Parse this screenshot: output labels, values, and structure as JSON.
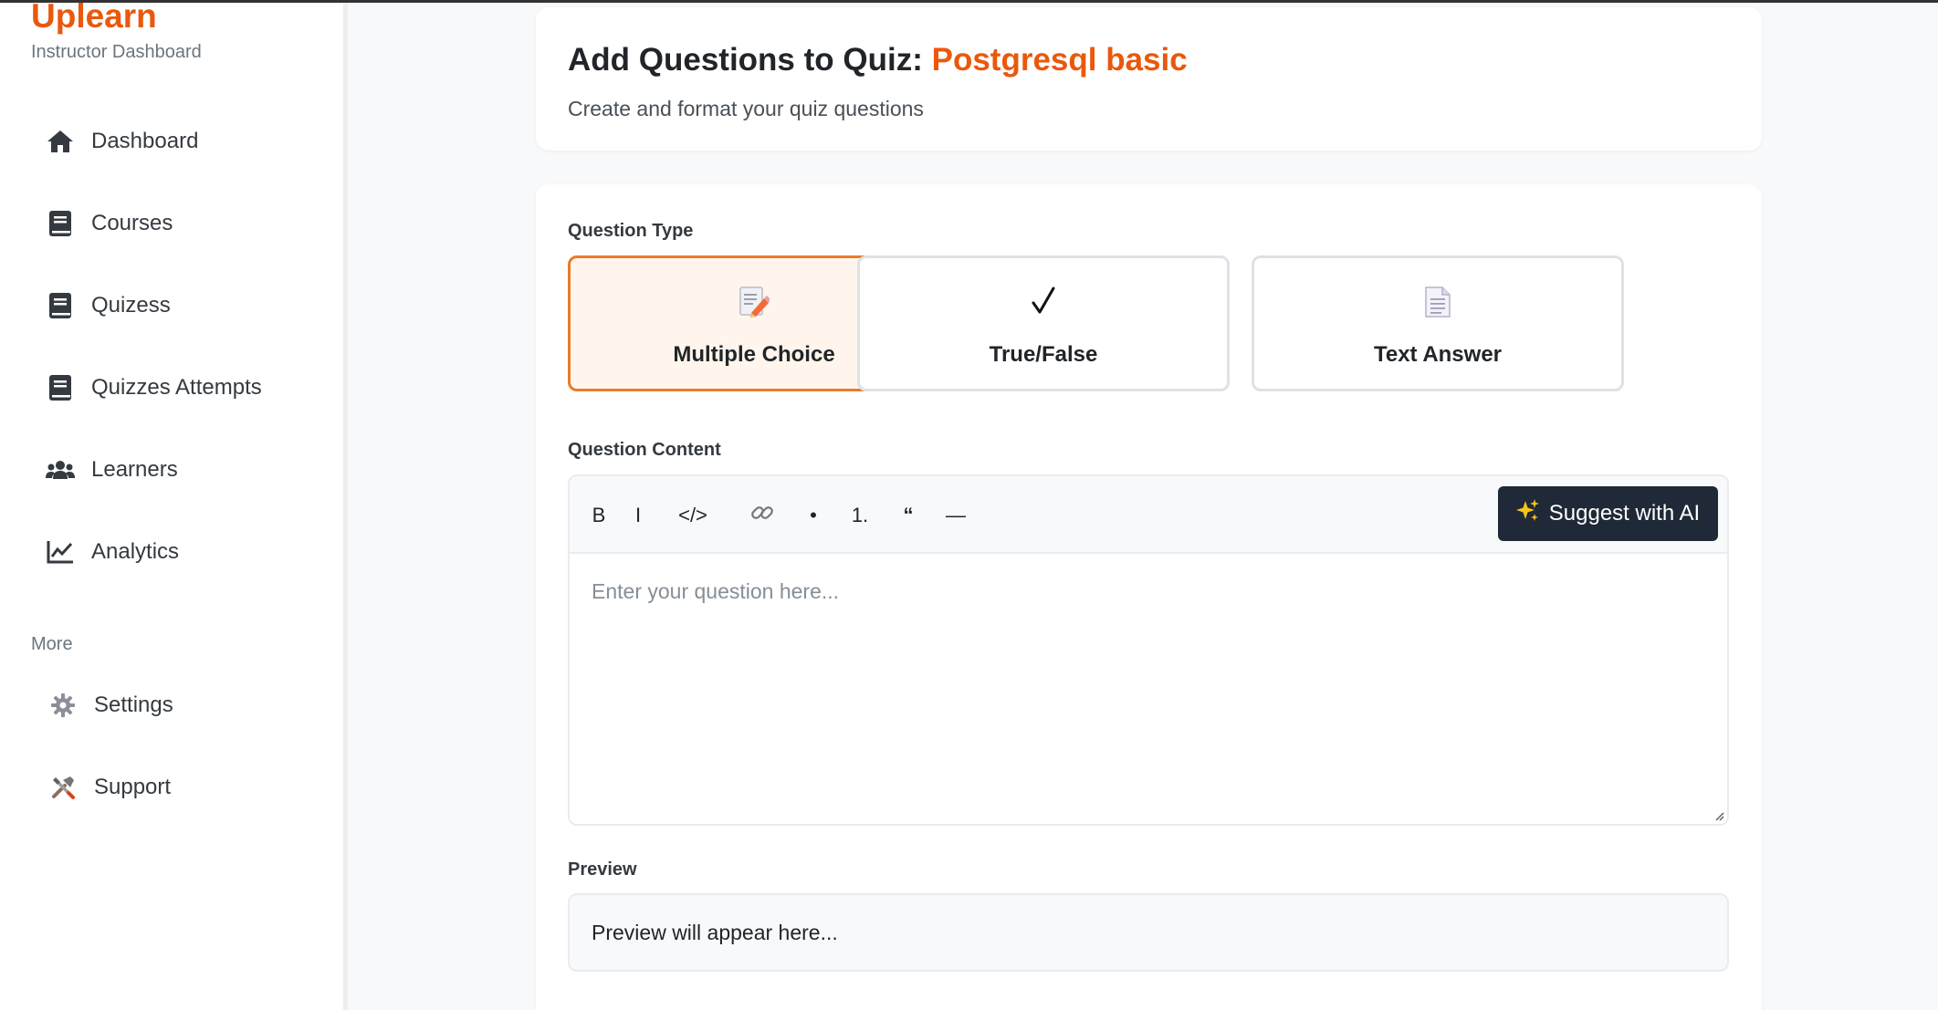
{
  "brand": {
    "name": "Uplearn",
    "subtitle": "Instructor Dashboard",
    "accent": "#ea580c"
  },
  "sidebar": {
    "items": [
      {
        "label": "Dashboard",
        "icon": "home-icon"
      },
      {
        "label": "Courses",
        "icon": "book-icon"
      },
      {
        "label": "Quizess",
        "icon": "book-icon"
      },
      {
        "label": "Quizzes Attempts",
        "icon": "book-icon"
      },
      {
        "label": "Learners",
        "icon": "users-icon"
      },
      {
        "label": "Analytics",
        "icon": "chart-line-icon"
      }
    ],
    "more_label": "More",
    "more_items": [
      {
        "label": "Settings",
        "icon": "gear-icon"
      },
      {
        "label": "Support",
        "icon": "tools-icon"
      }
    ]
  },
  "header": {
    "title_prefix": "Add Questions to Quiz: ",
    "quiz_name": "Postgresql basic",
    "subtitle": "Create and format your quiz questions"
  },
  "form": {
    "question_type_label": "Question Type",
    "question_types": [
      {
        "label": "Multiple Choice",
        "icon": "memo-pencil-icon",
        "selected": true
      },
      {
        "label": "True/False",
        "icon": "checkmark-icon",
        "selected": false
      },
      {
        "label": "Text Answer",
        "icon": "document-icon",
        "selected": false
      }
    ],
    "question_content_label": "Question Content",
    "toolbar": {
      "bold": "B",
      "italic": "I",
      "code": "</>",
      "bullet": "•",
      "numbered": "1.",
      "quote": "“",
      "divider": "—",
      "ai_button": "Suggest with AI"
    },
    "question_placeholder": "Enter your question here...",
    "question_value": "",
    "preview_label": "Preview",
    "preview_text": "Preview will appear here..."
  }
}
